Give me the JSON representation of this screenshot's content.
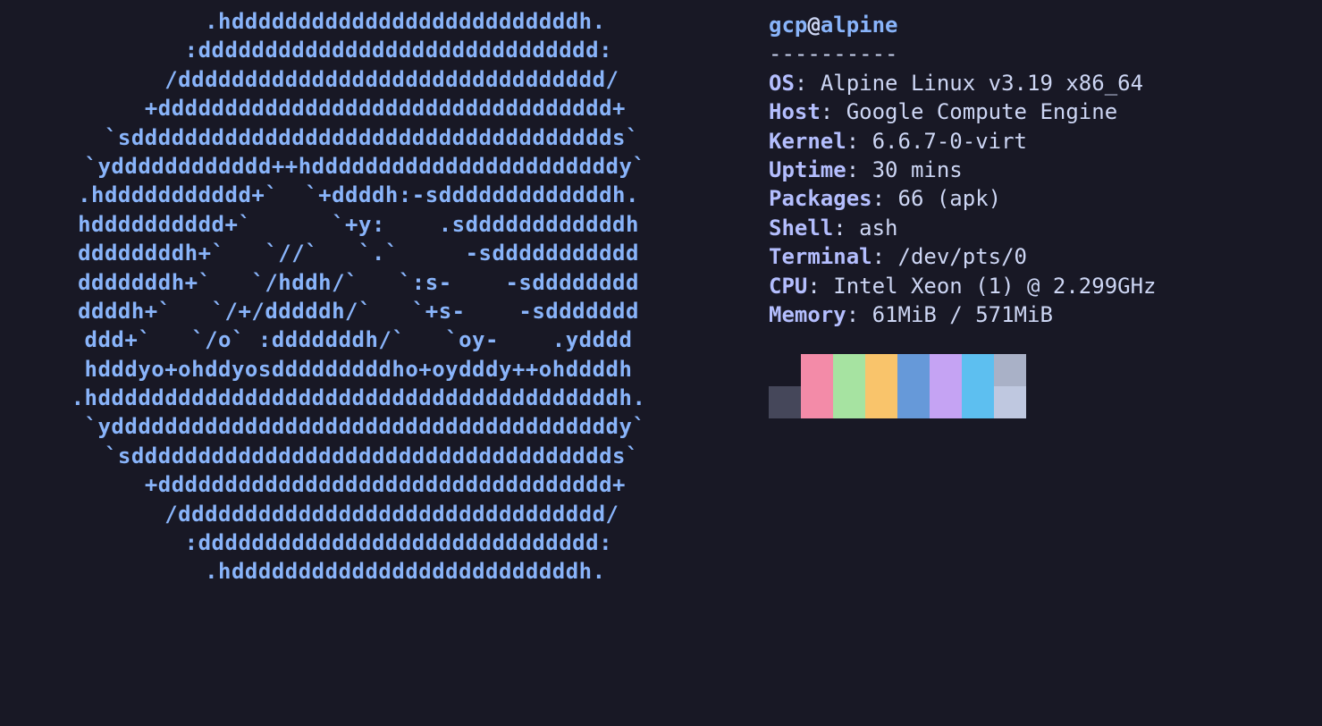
{
  "ascii_art": [
    "       .hddddddddddddddddddddddddddh.",
    "      :dddddddddddddddddddddddddddddd:",
    "     /dddddddddddddddddddddddddddddddd/",
    "    +dddddddddddddddddddddddddddddddddd+",
    "  `sdddddddddddddddddddddddddddddddddddds`",
    " `ydddddddddddd++hdddddddddddddddddddddddy`",
    ".hddddddddddd+`  `+ddddh:-sdddddddddddddh.",
    "hdddddddddd+`      `+y:    .sddddddddddddh",
    "ddddddddh+`   `//`   `.`     -sddddddddddd",
    "dddddddh+`   `/hddh/`   `:s-    -sdddddddd",
    "ddddh+`   `/+/dddddh/`   `+s-    -sddddddd",
    "ddd+`   `/o` :dddddddh/`   `oy-    .ydddd",
    "hdddyo+ohddyosdddddddddho+oydddy++ohddddh",
    ".hdddddddddddddddddddddddddddddddddddddddh.",
    " `yddddddddddddddddddddddddddddddddddddddy`",
    "  `sdddddddddddddddddddddddddddddddddddds`",
    "    +dddddddddddddddddddddddddddddddddd+",
    "     /dddddddddddddddddddddddddddddddd/",
    "      :dddddddddddddddddddddddddddddd:",
    "       .hddddddddddddddddddddddddddh."
  ],
  "user": "gcp",
  "host": "alpine",
  "separator": "----------",
  "info": [
    {
      "label": "OS",
      "value": "Alpine Linux v3.19 x86_64"
    },
    {
      "label": "Host",
      "value": "Google Compute Engine"
    },
    {
      "label": "Kernel",
      "value": "6.6.7-0-virt"
    },
    {
      "label": "Uptime",
      "value": "30 mins"
    },
    {
      "label": "Packages",
      "value": "66 (apk)"
    },
    {
      "label": "Shell",
      "value": "ash"
    },
    {
      "label": "Terminal",
      "value": "/dev/pts/0"
    },
    {
      "label": "CPU",
      "value": "Intel Xeon (1) @ 2.299GHz"
    },
    {
      "label": "Memory",
      "value": "61MiB / 571MiB"
    }
  ],
  "palette": {
    "row1": [
      "#181825",
      "#f38ba8",
      "#a6e3a1",
      "#f9c46b",
      "#6699d9",
      "#c5a3f3",
      "#5dbff0",
      "#a9b1c7"
    ],
    "row2": [
      "#45475a",
      "#f38ba8",
      "#a6e3a1",
      "#f9c46b",
      "#6699d9",
      "#c5a3f3",
      "#5dbff0",
      "#bfc8e0"
    ]
  }
}
